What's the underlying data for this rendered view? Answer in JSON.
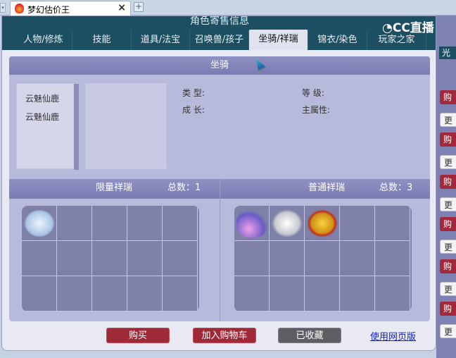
{
  "browser": {
    "tab_title": "梦幻估价王",
    "close": "×",
    "new_tab": "+",
    "dropdown": "▾"
  },
  "dialog": {
    "title": "角色寄售信息",
    "watermark": "CC直播",
    "tabs": [
      {
        "label": "人物/修炼"
      },
      {
        "label": "技能"
      },
      {
        "label": "道具/法宝"
      },
      {
        "label": "召唤兽/孩子"
      },
      {
        "label": "坐骑/祥瑞",
        "active": true
      },
      {
        "label": "锦衣/染色"
      },
      {
        "label": "玩家之家"
      }
    ],
    "mount": {
      "header": "坐骑",
      "list": [
        "云魅仙鹿",
        "云魅仙鹿"
      ],
      "fields": {
        "type": "类  型:",
        "growth": "成  长:",
        "level": "等  级:",
        "attr": "主属性:"
      }
    },
    "limited": {
      "title": "限量祥瑞",
      "count_label": "总数：1",
      "items": [
        "ice-spirit"
      ]
    },
    "normal": {
      "title": "普通祥瑞",
      "count_label": "总数：3",
      "items": [
        "pink-butterfly",
        "white-horse",
        "golden-lion"
      ]
    },
    "buttons": {
      "buy": "购买",
      "cart": "加入购物车",
      "fav": "已收藏",
      "web": "使用网页版"
    }
  },
  "right_side": {
    "red": "购",
    "white": "更",
    "top": "光"
  },
  "colors": {
    "header": "#1d4f63",
    "panel": "#b8badb",
    "buy": "#9e2a38"
  }
}
